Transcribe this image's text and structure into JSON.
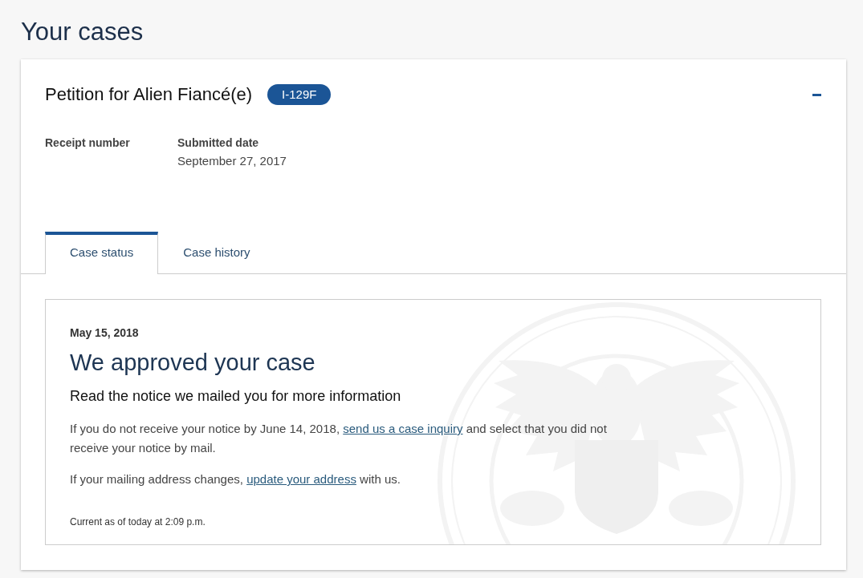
{
  "page_title": "Your cases",
  "case": {
    "title": "Petition for Alien Fiancé(e)",
    "form_badge": "I-129F",
    "expanded": true,
    "fields": [
      {
        "label": "Receipt number"
      },
      {
        "label": "Submitted date",
        "value": "September 27, 2017"
      }
    ],
    "tabs": [
      {
        "label": "Case status",
        "selected": true
      },
      {
        "label": "Case history",
        "selected": false
      }
    ],
    "status": {
      "date": "May 15, 2018",
      "heading": "We approved your case",
      "subheading": "Read the notice we mailed you for more information",
      "paragraphs": [
        {
          "before": "If you do not receive your notice by June 14, 2018,",
          "link": "send us a case inquiry",
          "after": "and select that you did not receive your notice by mail."
        },
        {
          "before": "If your mailing address changes,",
          "link": "update your address",
          "after": "with us."
        }
      ],
      "updated": "Current as of today at 2:09 p.m."
    }
  }
}
